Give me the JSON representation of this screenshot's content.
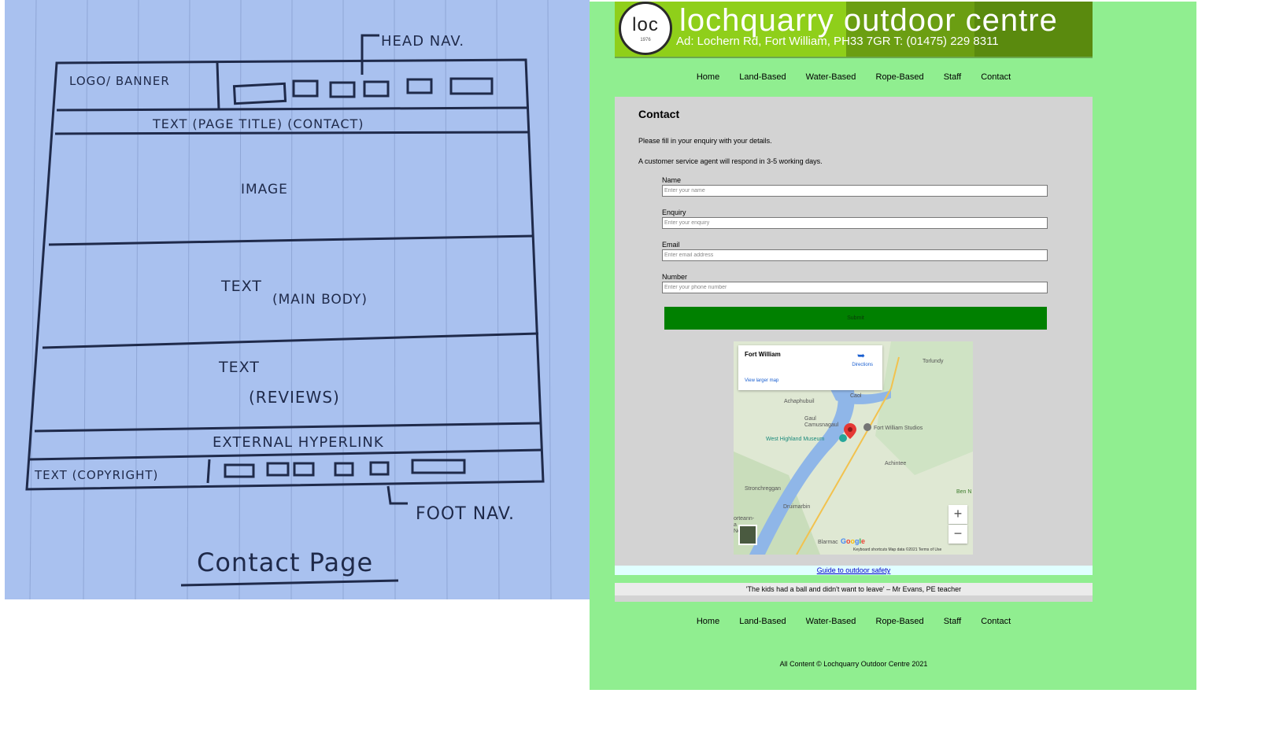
{
  "sketch": {
    "box_logo": "LOGO/ BANNER",
    "head_nav": "HEAD NAV.",
    "page_title": "TEXT (PAGE TITLE) (CONTACT)",
    "image": "IMAGE",
    "main_text_1": "TEXT",
    "main_text_2": "(MAIN BODY)",
    "reviews_1": "TEXT",
    "reviews_2": "(REVIEWS)",
    "external": "EXTERNAL HYPERLINK",
    "copyright": "TEXT (COPYRIGHT)",
    "foot_nav": "FOOT NAV.",
    "caption": "Contact Page"
  },
  "site": {
    "logo_text": "loc",
    "logo_year": "1976",
    "brand": "lochquarry outdoor centre",
    "address": "Ad: Lochern Rd, Fort William, PH33 7GR T: (01475) 229 8311",
    "nav": [
      "Home",
      "Land-Based",
      "Water-Based",
      "Rope-Based",
      "Staff",
      "Contact"
    ],
    "title": "Contact",
    "intro": "Please fill in your enquiry with your details.",
    "response": "A customer service agent will respond in 3-5 working days.",
    "form": {
      "name_label": "Name",
      "name_placeholder": "Enter your name",
      "enquiry_label": "Enquiry",
      "enquiry_placeholder": "Enter your enquiry",
      "email_label": "Email",
      "email_placeholder": "Enter email address",
      "number_label": "Number",
      "number_placeholder": "Enter your phone number",
      "submit": "Submit"
    },
    "map": {
      "place": "Fort William",
      "directions": "Directions",
      "larger": "View larger map",
      "labels": [
        "Torlundy",
        "Achaphubuil",
        "Caol",
        "Gaul Camusnagaul",
        "Fort William Studios",
        "West Highland Museum",
        "Achintee",
        "Stronchreggan",
        "Druimarbin",
        "Ben N",
        "Blarmac",
        "orteann-a Nerdich"
      ],
      "google": "Google",
      "footer": "Keyboard shortcuts   Map data ©2021   Terms of Use"
    },
    "external_link": "Guide to outdoor safety",
    "review": "'The kids had a ball and didn't want to leave' – Mr Evans, PE teacher",
    "copyright": "All Content © Lochquarry Outdoor Centre 2021",
    "colors": {
      "page_bg": "#90ee90",
      "content_bg": "#d3d3d3",
      "submit_bg": "#008000",
      "banner_light": "#8fcf1a",
      "banner_dark": "#5a8a0e"
    }
  }
}
